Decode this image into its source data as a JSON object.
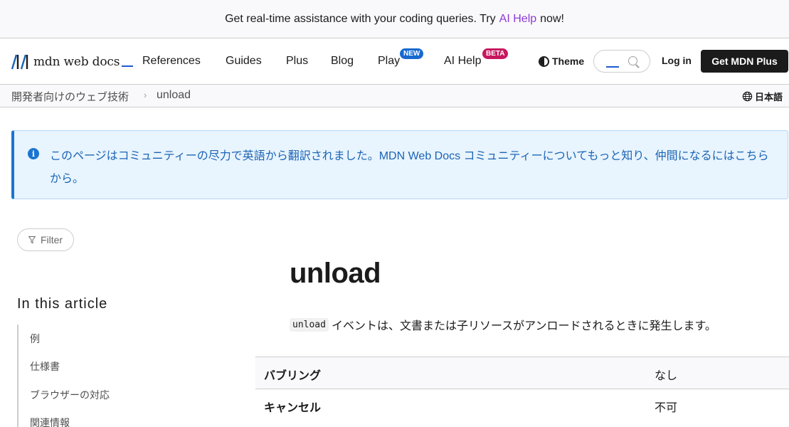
{
  "promo": {
    "before": "Get real-time assistance with your coding queries. Try",
    "link": "AI Help",
    "after": "now!"
  },
  "header": {
    "logo_text": "mdn web docs",
    "menu": [
      {
        "label": "References"
      },
      {
        "label": "Guides"
      },
      {
        "label": "Plus"
      },
      {
        "label": "Blog"
      },
      {
        "label": "Play",
        "badge": "NEW"
      },
      {
        "label": "AI Help",
        "badge": "BETA"
      }
    ],
    "theme_label": "Theme",
    "login_label": "Log in",
    "get_plus_label": "Get MDN Plus"
  },
  "breadcrumb": {
    "parent": "開発者向けのウェブ技術",
    "separator": "›",
    "current": "unload",
    "language": "日本語"
  },
  "notice": {
    "icon": "i",
    "text": "このページはコミュニティーの尽力で英語から翻訳されました。MDN Web Docs コミュニティーについてもっと知り、仲間になるにはこちらから。"
  },
  "sidebar": {
    "filter_label": "Filter",
    "toc_title": "In this article",
    "toc_items": [
      "例",
      "仕様書",
      "ブラウザーの対応",
      "関連情報"
    ]
  },
  "article": {
    "title": "unload",
    "intro_code": "unload",
    "intro_text": "イベントは、文書または子リソースがアンロードされるときに発生します。",
    "table": [
      {
        "label": "バブリング",
        "value": "なし"
      },
      {
        "label": "キャンセル",
        "value": "不可"
      }
    ]
  },
  "colors": {
    "accent_purple": "#8e3ad6",
    "notice_blue": "#1b64b5",
    "badge_new": "#1769cf",
    "badge_beta": "#c7175f"
  }
}
